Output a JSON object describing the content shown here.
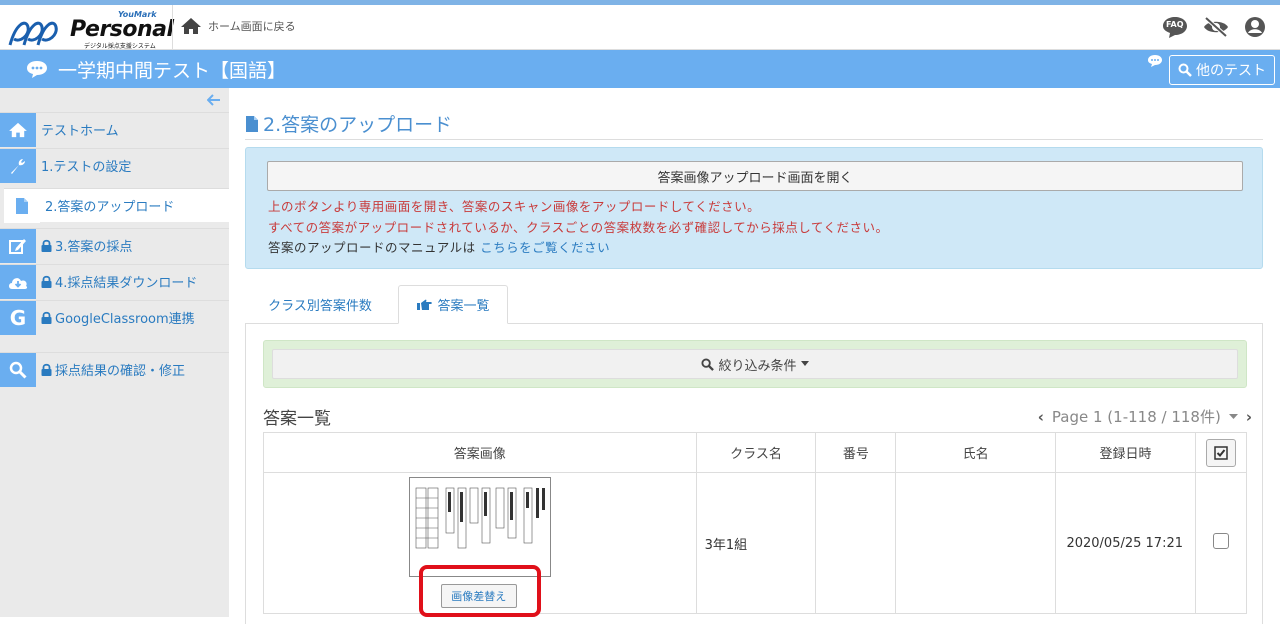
{
  "header": {
    "logo_top": "YouMark",
    "logo_brand": "Personal",
    "logo_sub": "デジタル採点支援システム",
    "home_link": "ホーム画面に戻る",
    "faq_label": "FAQ"
  },
  "titlebar": {
    "title": "一学期中間テスト【国語】",
    "other_test": "他のテスト"
  },
  "sidebar": {
    "items": [
      {
        "label": "テストホーム",
        "locked": false
      },
      {
        "label": "1.テストの設定",
        "locked": false
      },
      {
        "label": "2.答案のアップロード",
        "locked": false,
        "active": true
      },
      {
        "label": "3.答案の採点",
        "locked": true
      },
      {
        "label": "4.採点結果ダウンロード",
        "locked": true
      },
      {
        "label": "GoogleClassroom連携",
        "locked": true
      },
      {
        "label": "採点結果の確認・修正",
        "locked": true
      }
    ]
  },
  "main": {
    "section_title": "2.答案のアップロード",
    "open_button": "答案画像アップロード画面を開く",
    "notice1": "上のボタンより専用画面を開き、答案のスキャン画像をアップロードしてください。",
    "notice2": "すべての答案がアップロードされているか、クラスごとの答案枚数を必ず確認してから採点してください。",
    "manual_prefix": "答案のアップロードのマニュアルは",
    "manual_link": "こちらをご覧ください",
    "tabs": [
      "クラス別答案件数",
      "答案一覧"
    ],
    "filter_label": "絞り込み条件",
    "list_title": "答案一覧",
    "pager": "Page 1 (1-118 / 118件)",
    "table": {
      "headers": [
        "答案画像",
        "クラス名",
        "番号",
        "氏名",
        "登録日時"
      ],
      "rows": [
        {
          "class": "3年1組",
          "number": "",
          "name": "",
          "date": "2020/05/25 17:21",
          "replace_button": "画像差替え"
        }
      ]
    }
  },
  "colors": {
    "accent": "#6aaef0",
    "link": "#2a7bc0",
    "warning": "#c83a3a",
    "highlight": "#e0101a"
  }
}
